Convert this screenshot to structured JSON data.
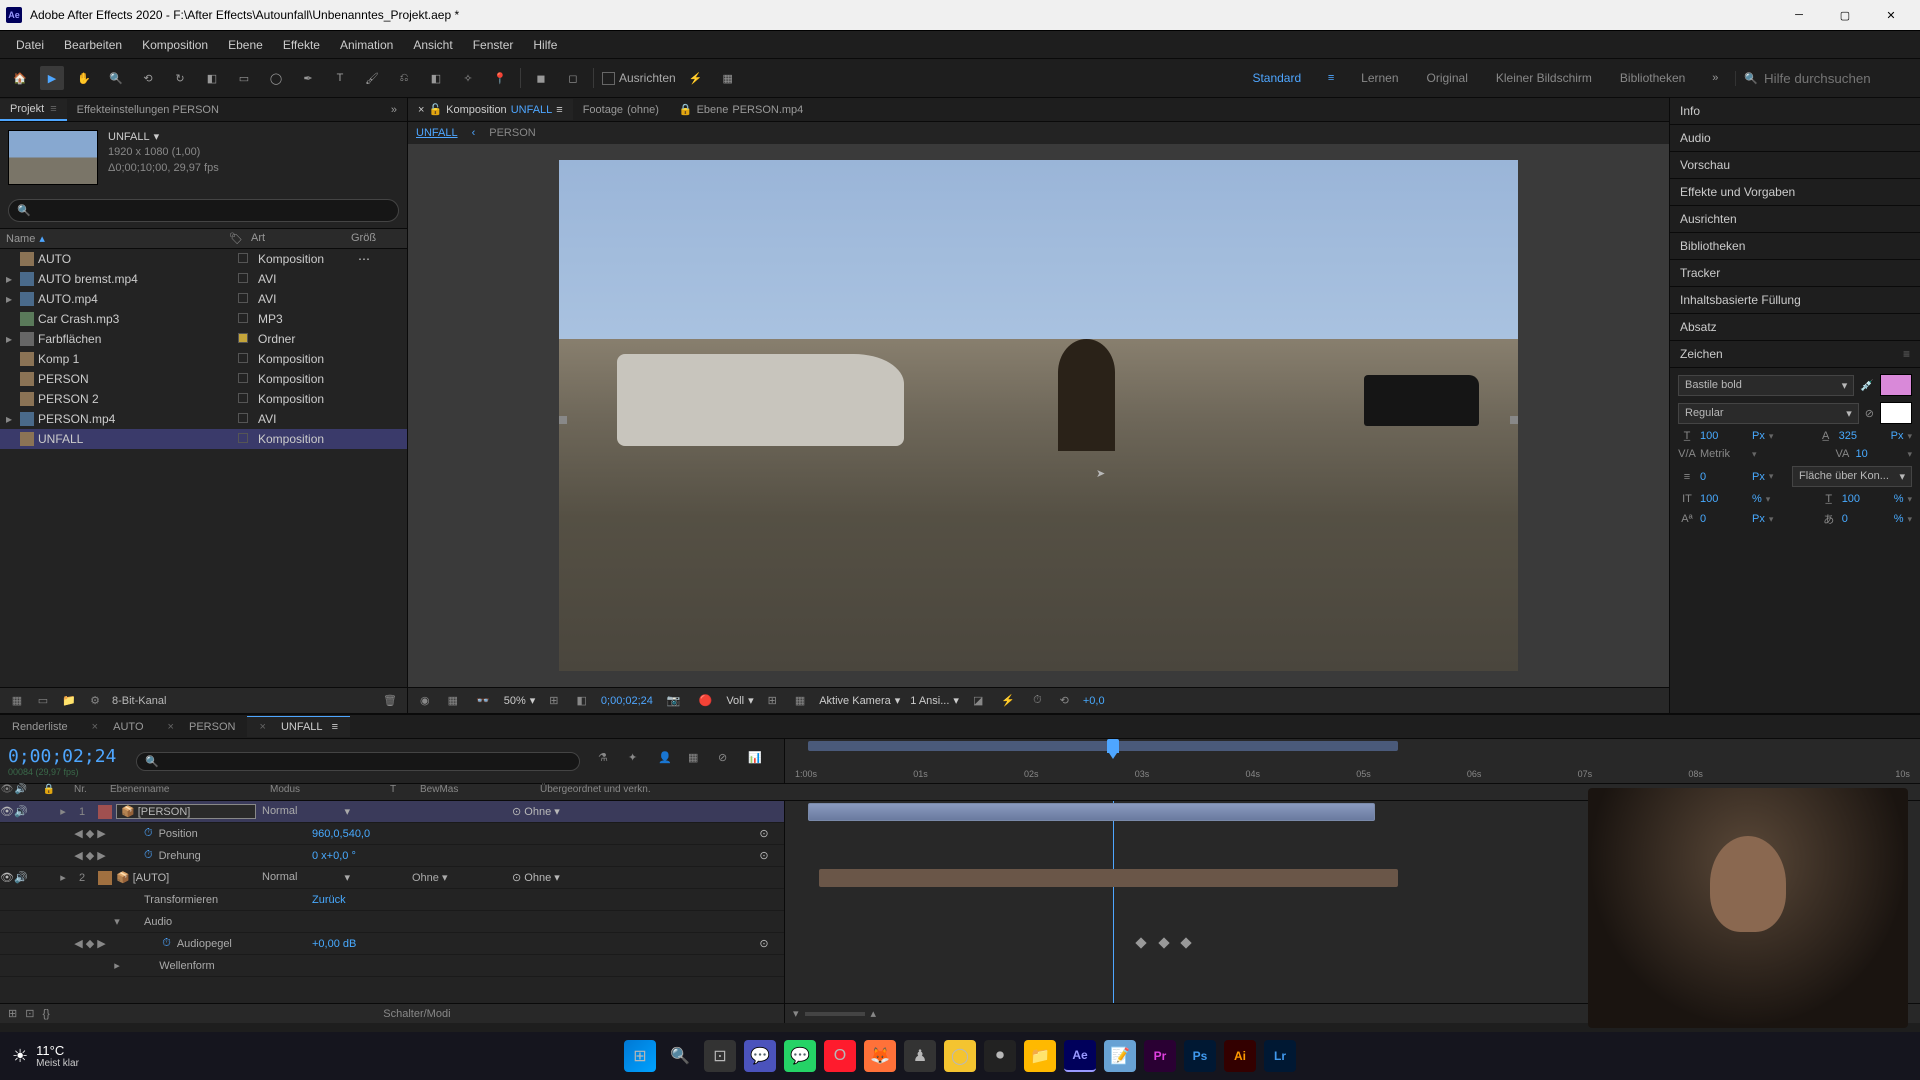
{
  "titlebar": {
    "app_name": "Ae",
    "title": "Adobe After Effects 2020 - F:\\After Effects\\Autounfall\\Unbenanntes_Projekt.aep *"
  },
  "menu": [
    "Datei",
    "Bearbeiten",
    "Komposition",
    "Ebene",
    "Effekte",
    "Animation",
    "Ansicht",
    "Fenster",
    "Hilfe"
  ],
  "toolbar": {
    "align_label": "Ausrichten",
    "workspaces": [
      "Standard",
      "Lernen",
      "Original",
      "Kleiner Bildschirm",
      "Bibliotheken"
    ],
    "search_placeholder": "Hilfe durchsuchen"
  },
  "project_panel": {
    "tab_project": "Projekt",
    "tab_effects": "Effekteinstellungen  PERSON",
    "comp_name": "UNFALL",
    "dimensions": "1920 x 1080 (1,00)",
    "fps": "Δ0;00;10;00, 29,97 fps",
    "cols": {
      "name": "Name",
      "type": "Art",
      "size": "Größ"
    },
    "items": [
      {
        "name": "AUTO",
        "type": "Komposition",
        "icon": "comp",
        "tag": "",
        "misc": "⋯"
      },
      {
        "name": "AUTO bremst.mp4",
        "type": "AVI",
        "icon": "avi",
        "expand": "▸"
      },
      {
        "name": "AUTO.mp4",
        "type": "AVI",
        "icon": "avi",
        "expand": "▸"
      },
      {
        "name": "Car Crash.mp3",
        "type": "MP3",
        "icon": "mp3"
      },
      {
        "name": "Farbflächen",
        "type": "Ordner",
        "icon": "folder",
        "expand": "▸",
        "tag": "yellow"
      },
      {
        "name": "Komp 1",
        "type": "Komposition",
        "icon": "comp"
      },
      {
        "name": "PERSON",
        "type": "Komposition",
        "icon": "comp"
      },
      {
        "name": "PERSON 2",
        "type": "Komposition",
        "icon": "comp"
      },
      {
        "name": "PERSON.mp4",
        "type": "AVI",
        "icon": "avi",
        "expand": "▸"
      },
      {
        "name": "UNFALL",
        "type": "Komposition",
        "icon": "comp",
        "selected": true
      }
    ],
    "footer_depth": "8-Bit-Kanal"
  },
  "comp_viewer": {
    "tabs": [
      {
        "label_pre": "Komposition",
        "label": "UNFALL",
        "active": true,
        "locked": false
      },
      {
        "label_pre": "Footage",
        "label": "(ohne)"
      },
      {
        "label_pre": "Ebene",
        "label": "PERSON.mp4"
      }
    ],
    "subtabs": [
      "UNFALL",
      "PERSON"
    ],
    "footer": {
      "zoom": "50%",
      "timecode": "0;00;02;24",
      "quality": "Voll",
      "camera": "Aktive Kamera",
      "views": "1 Ansi...",
      "exposure": "+0,0"
    }
  },
  "right_panels": [
    "Info",
    "Audio",
    "Vorschau",
    "Effekte und Vorgaben",
    "Ausrichten",
    "Bibliotheken",
    "Tracker",
    "Inhaltsbasierte Füllung",
    "Absatz"
  ],
  "char_panel": {
    "title": "Zeichen",
    "font": "Bastile bold",
    "style": "Regular",
    "size_val": "100",
    "size_unit": "Px",
    "leading_val": "325",
    "leading_unit": "Px",
    "kerning": "Metrik",
    "tracking": "10",
    "stroke_w": "0",
    "stroke_unit": "Px",
    "stroke_opt": "Fläche über Kon...",
    "vscale": "100",
    "vscale_unit": "%",
    "hscale": "100",
    "hscale_unit": "%",
    "baseline": "0",
    "baseline_unit": "Px",
    "tsume": "0",
    "tsume_unit": "%"
  },
  "timeline": {
    "tabs": [
      {
        "label": "Renderliste"
      },
      {
        "label": "AUTO"
      },
      {
        "label": "PERSON"
      },
      {
        "label": "UNFALL",
        "active": true
      }
    ],
    "timecode": "0;00;02;24",
    "timecode_sub": "00084 (29,97 fps)",
    "ruler": [
      "1:00s",
      "01s",
      "02s",
      "03s",
      "04s",
      "05s",
      "06s",
      "07s",
      "08s",
      "",
      "10s"
    ],
    "col_headers": {
      "nr": "Nr.",
      "name": "Ebenenname",
      "mode": "Modus",
      "t": "T",
      "trk": "BewMas",
      "parent": "Übergeordnet und verkn."
    },
    "layers": [
      {
        "num": "1",
        "name": "[PERSON]",
        "mode": "Normal",
        "parent": "Ohne",
        "selected": true,
        "color": "red",
        "props": [
          {
            "name": "Position",
            "val": "960,0,540,0",
            "kf": true
          },
          {
            "name": "Drehung",
            "val": "0 x+0,0 °",
            "kf": true
          }
        ]
      },
      {
        "num": "2",
        "name": "[AUTO]",
        "mode": "Normal",
        "trk": "Ohne",
        "parent": "Ohne",
        "color": "orange",
        "props": [
          {
            "name": "Transformieren",
            "val": "Zurück",
            "header": true
          },
          {
            "name": "Audio",
            "header": true,
            "expand": "▾"
          },
          {
            "name": "Audiopegel",
            "val": "+0,00 dB",
            "kf": true,
            "indent": true
          },
          {
            "name": "Wellenform",
            "header": true,
            "expand": "▸",
            "indent": true
          }
        ]
      }
    ],
    "footer_text": "Schalter/Modi"
  },
  "taskbar": {
    "temp": "11°C",
    "weather": "Meist klar"
  }
}
